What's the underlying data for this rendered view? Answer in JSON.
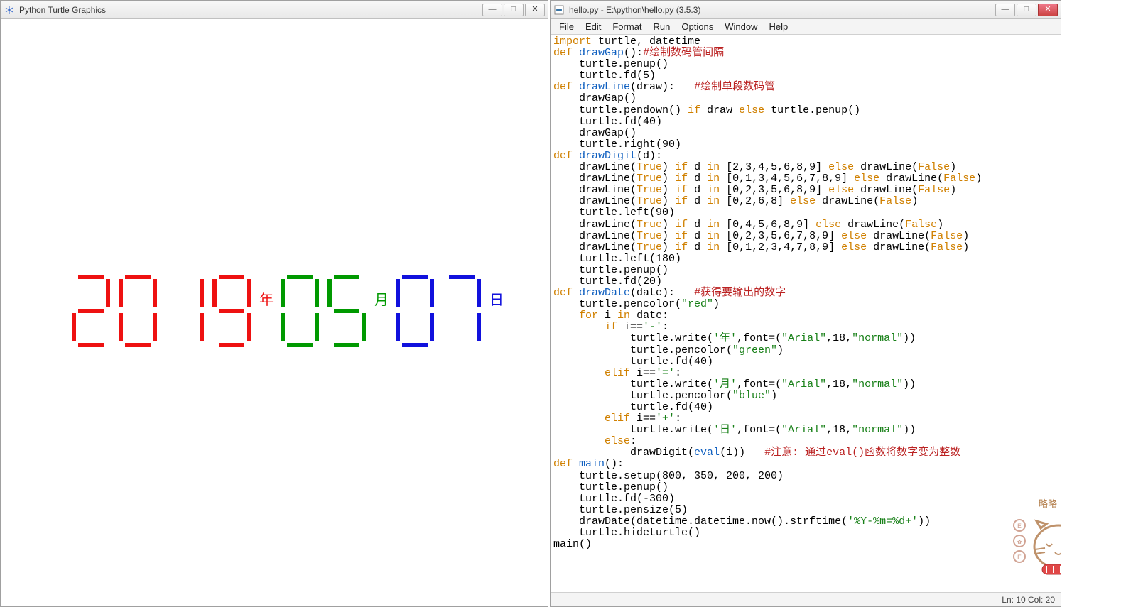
{
  "turtle": {
    "title": "Python Turtle Graphics",
    "date": {
      "year_digits": [
        "2",
        "0",
        "1",
        "9"
      ],
      "year_label": "年",
      "month_digits": [
        "0",
        "5"
      ],
      "month_label": "月",
      "day_digits": [
        "0",
        "7"
      ],
      "day_label": "日"
    }
  },
  "idle": {
    "title": "hello.py - E:\\python\\hello.py (3.5.3)",
    "menu": [
      "File",
      "Edit",
      "Format",
      "Run",
      "Options",
      "Window",
      "Help"
    ],
    "status": {
      "line": 10,
      "col": 20,
      "text": "Ln: 10  Col: 20"
    },
    "code_lines": [
      {
        "t": [
          [
            "kw",
            "import"
          ],
          [
            "",
            " turtle, datetime"
          ]
        ]
      },
      {
        "t": [
          [
            "kw",
            "def"
          ],
          [
            "",
            " "
          ],
          [
            "fn",
            "drawGap"
          ],
          [
            "",
            "():"
          ],
          [
            "cm",
            "#绘制数码管间隔"
          ]
        ]
      },
      {
        "t": [
          [
            "",
            "    turtle.penup()"
          ]
        ]
      },
      {
        "t": [
          [
            "",
            "    turtle.fd(5)"
          ]
        ]
      },
      {
        "t": [
          [
            "kw",
            "def"
          ],
          [
            "",
            " "
          ],
          [
            "fn",
            "drawLine"
          ],
          [
            "",
            "(draw):   "
          ],
          [
            "cm",
            "#绘制单段数码管"
          ]
        ]
      },
      {
        "t": [
          [
            "",
            "    drawGap()"
          ]
        ]
      },
      {
        "t": [
          [
            "",
            "    turtle.pendown() "
          ],
          [
            "kw",
            "if"
          ],
          [
            "",
            " draw "
          ],
          [
            "kw",
            "else"
          ],
          [
            "",
            " turtle.penup()"
          ]
        ]
      },
      {
        "t": [
          [
            "",
            "    turtle.fd(40)"
          ]
        ]
      },
      {
        "t": [
          [
            "",
            "    drawGap()"
          ]
        ]
      },
      {
        "t": [
          [
            "",
            "    turtle.right(90)"
          ],
          [
            "caret",
            ""
          ]
        ]
      },
      {
        "t": [
          [
            "kw",
            "def"
          ],
          [
            "",
            " "
          ],
          [
            "fn",
            "drawDigit"
          ],
          [
            "",
            "(d):"
          ]
        ]
      },
      {
        "t": [
          [
            "",
            "    drawLine("
          ],
          [
            "kw",
            "True"
          ],
          [
            "",
            ") "
          ],
          [
            "kw",
            "if"
          ],
          [
            "",
            " d "
          ],
          [
            "kw",
            "in"
          ],
          [
            "",
            " [2,3,4,5,6,8,9] "
          ],
          [
            "kw",
            "else"
          ],
          [
            "",
            " drawLine("
          ],
          [
            "kw",
            "False"
          ],
          [
            "",
            ")"
          ]
        ]
      },
      {
        "t": [
          [
            "",
            "    drawLine("
          ],
          [
            "kw",
            "True"
          ],
          [
            "",
            ") "
          ],
          [
            "kw",
            "if"
          ],
          [
            "",
            " d "
          ],
          [
            "kw",
            "in"
          ],
          [
            "",
            " [0,1,3,4,5,6,7,8,9] "
          ],
          [
            "kw",
            "else"
          ],
          [
            "",
            " drawLine("
          ],
          [
            "kw",
            "False"
          ],
          [
            "",
            ")"
          ]
        ]
      },
      {
        "t": [
          [
            "",
            "    drawLine("
          ],
          [
            "kw",
            "True"
          ],
          [
            "",
            ") "
          ],
          [
            "kw",
            "if"
          ],
          [
            "",
            " d "
          ],
          [
            "kw",
            "in"
          ],
          [
            "",
            " [0,2,3,5,6,8,9] "
          ],
          [
            "kw",
            "else"
          ],
          [
            "",
            " drawLine("
          ],
          [
            "kw",
            "False"
          ],
          [
            "",
            ")"
          ]
        ]
      },
      {
        "t": [
          [
            "",
            "    drawLine("
          ],
          [
            "kw",
            "True"
          ],
          [
            "",
            ") "
          ],
          [
            "kw",
            "if"
          ],
          [
            "",
            " d "
          ],
          [
            "kw",
            "in"
          ],
          [
            "",
            " [0,2,6,8] "
          ],
          [
            "kw",
            "else"
          ],
          [
            "",
            " drawLine("
          ],
          [
            "kw",
            "False"
          ],
          [
            "",
            ")"
          ]
        ]
      },
      {
        "t": [
          [
            "",
            "    turtle.left(90)"
          ]
        ]
      },
      {
        "t": [
          [
            "",
            "    drawLine("
          ],
          [
            "kw",
            "True"
          ],
          [
            "",
            ") "
          ],
          [
            "kw",
            "if"
          ],
          [
            "",
            " d "
          ],
          [
            "kw",
            "in"
          ],
          [
            "",
            " [0,4,5,6,8,9] "
          ],
          [
            "kw",
            "else"
          ],
          [
            "",
            " drawLine("
          ],
          [
            "kw",
            "False"
          ],
          [
            "",
            ")"
          ]
        ]
      },
      {
        "t": [
          [
            "",
            "    drawLine("
          ],
          [
            "kw",
            "True"
          ],
          [
            "",
            ") "
          ],
          [
            "kw",
            "if"
          ],
          [
            "",
            " d "
          ],
          [
            "kw",
            "in"
          ],
          [
            "",
            " [0,2,3,5,6,7,8,9] "
          ],
          [
            "kw",
            "else"
          ],
          [
            "",
            " drawLine("
          ],
          [
            "kw",
            "False"
          ],
          [
            "",
            ")"
          ]
        ]
      },
      {
        "t": [
          [
            "",
            "    drawLine("
          ],
          [
            "kw",
            "True"
          ],
          [
            "",
            ") "
          ],
          [
            "kw",
            "if"
          ],
          [
            "",
            " d "
          ],
          [
            "kw",
            "in"
          ],
          [
            "",
            " [0,1,2,3,4,7,8,9] "
          ],
          [
            "kw",
            "else"
          ],
          [
            "",
            " drawLine("
          ],
          [
            "kw",
            "False"
          ],
          [
            "",
            ")"
          ]
        ]
      },
      {
        "t": [
          [
            "",
            "    turtle.left(180)"
          ]
        ]
      },
      {
        "t": [
          [
            "",
            "    turtle.penup()"
          ]
        ]
      },
      {
        "t": [
          [
            "",
            "    turtle.fd(20)"
          ]
        ]
      },
      {
        "t": [
          [
            "kw",
            "def"
          ],
          [
            "",
            " "
          ],
          [
            "fn",
            "drawDate"
          ],
          [
            "",
            "(date):   "
          ],
          [
            "cm",
            "#获得要输出的数字"
          ]
        ]
      },
      {
        "t": [
          [
            "",
            "    turtle.pencolor("
          ],
          [
            "str",
            "\"red\""
          ],
          [
            "",
            ")"
          ]
        ]
      },
      {
        "t": [
          [
            "",
            "    "
          ],
          [
            "kw",
            "for"
          ],
          [
            "",
            " i "
          ],
          [
            "kw",
            "in"
          ],
          [
            "",
            " date:"
          ]
        ]
      },
      {
        "t": [
          [
            "",
            "        "
          ],
          [
            "kw",
            "if"
          ],
          [
            "",
            " i=="
          ],
          [
            "str",
            "'-'"
          ],
          [
            "",
            ":"
          ]
        ]
      },
      {
        "t": [
          [
            "",
            "            turtle.write("
          ],
          [
            "str",
            "'年'"
          ],
          [
            "",
            ",font=("
          ],
          [
            "str",
            "\"Arial\""
          ],
          [
            "",
            ",18,"
          ],
          [
            "str",
            "\"normal\""
          ],
          [
            "",
            "))"
          ]
        ]
      },
      {
        "t": [
          [
            "",
            "            turtle.pencolor("
          ],
          [
            "str",
            "\"green\""
          ],
          [
            "",
            ")"
          ]
        ]
      },
      {
        "t": [
          [
            "",
            "            turtle.fd(40)"
          ]
        ]
      },
      {
        "t": [
          [
            "",
            "        "
          ],
          [
            "kw",
            "elif"
          ],
          [
            "",
            " i=="
          ],
          [
            "str",
            "'='"
          ],
          [
            "",
            ":"
          ]
        ]
      },
      {
        "t": [
          [
            "",
            "            turtle.write("
          ],
          [
            "str",
            "'月'"
          ],
          [
            "",
            ",font=("
          ],
          [
            "str",
            "\"Arial\""
          ],
          [
            "",
            ",18,"
          ],
          [
            "str",
            "\"normal\""
          ],
          [
            "",
            "))"
          ]
        ]
      },
      {
        "t": [
          [
            "",
            "            turtle.pencolor("
          ],
          [
            "str",
            "\"blue\""
          ],
          [
            "",
            ")"
          ]
        ]
      },
      {
        "t": [
          [
            "",
            "            turtle.fd(40)"
          ]
        ]
      },
      {
        "t": [
          [
            "",
            "        "
          ],
          [
            "kw",
            "elif"
          ],
          [
            "",
            " i=="
          ],
          [
            "str",
            "'+'"
          ],
          [
            "",
            ":"
          ]
        ]
      },
      {
        "t": [
          [
            "",
            "            turtle.write("
          ],
          [
            "str",
            "'日'"
          ],
          [
            "",
            ",font=("
          ],
          [
            "str",
            "\"Arial\""
          ],
          [
            "",
            ",18,"
          ],
          [
            "str",
            "\"normal\""
          ],
          [
            "",
            "))"
          ]
        ]
      },
      {
        "t": [
          [
            "",
            "        "
          ],
          [
            "kw",
            "else"
          ],
          [
            "",
            ":"
          ]
        ]
      },
      {
        "t": [
          [
            "",
            "            drawDigit("
          ],
          [
            "fn",
            "eval"
          ],
          [
            "",
            "(i))   "
          ],
          [
            "cm",
            "#注意: 通过eval()函数将数字变为整数"
          ]
        ]
      },
      {
        "t": [
          [
            "kw",
            "def"
          ],
          [
            "",
            " "
          ],
          [
            "fn",
            "main"
          ],
          [
            "",
            "():"
          ]
        ]
      },
      {
        "t": [
          [
            "",
            "    turtle.setup(800, 350, 200, 200)"
          ]
        ]
      },
      {
        "t": [
          [
            "",
            "    turtle.penup()"
          ]
        ]
      },
      {
        "t": [
          [
            "",
            "    turtle.fd(-300)"
          ]
        ]
      },
      {
        "t": [
          [
            "",
            "    turtle.pensize(5)"
          ]
        ]
      },
      {
        "t": [
          [
            "",
            "    drawDate(datetime.datetime.now().strftime("
          ],
          [
            "str",
            "'%Y-%m=%d+'"
          ],
          [
            "",
            "))"
          ]
        ]
      },
      {
        "t": [
          [
            "",
            "    turtle.hideturtle()"
          ]
        ]
      },
      {
        "t": [
          [
            "",
            "main()"
          ]
        ]
      }
    ]
  },
  "seg_map": {
    "0": [
      "a",
      "b",
      "c",
      "d",
      "e",
      "f"
    ],
    "1": [
      "b",
      "c"
    ],
    "2": [
      "a",
      "b",
      "g",
      "e",
      "d"
    ],
    "3": [
      "a",
      "b",
      "g",
      "c",
      "d"
    ],
    "4": [
      "f",
      "g",
      "b",
      "c"
    ],
    "5": [
      "a",
      "f",
      "g",
      "c",
      "d"
    ],
    "6": [
      "a",
      "f",
      "g",
      "e",
      "c",
      "d"
    ],
    "7": [
      "a",
      "b",
      "c"
    ],
    "8": [
      "a",
      "b",
      "c",
      "d",
      "e",
      "f",
      "g"
    ],
    "9": [
      "a",
      "b",
      "c",
      "d",
      "f",
      "g"
    ]
  },
  "mascot": {
    "label": "略略"
  }
}
